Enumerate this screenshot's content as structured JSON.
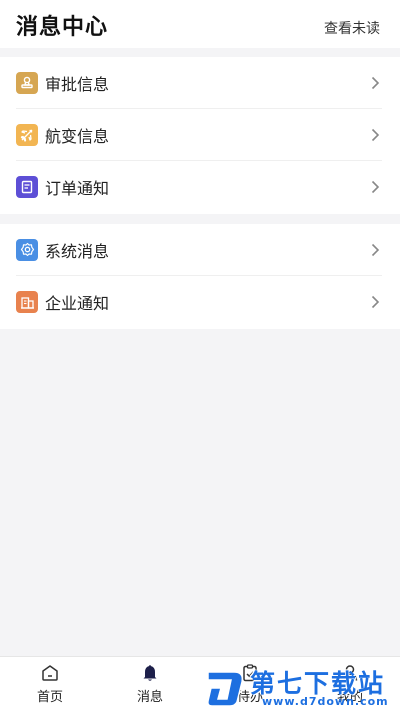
{
  "header": {
    "title": "消息中心",
    "view_unread": "查看未读"
  },
  "groups": [
    {
      "items": [
        {
          "label": "审批信息",
          "icon": "stamp-icon",
          "color": "#d6a652"
        },
        {
          "label": "航变信息",
          "icon": "airplane-icon",
          "color": "#f2b552"
        },
        {
          "label": "订单通知",
          "icon": "document-icon",
          "color": "#5d4fd6"
        }
      ]
    },
    {
      "items": [
        {
          "label": "系统消息",
          "icon": "gear-icon",
          "color": "#4a8fe4"
        },
        {
          "label": "企业通知",
          "icon": "building-icon",
          "color": "#e8824e"
        }
      ]
    }
  ],
  "tabbar": {
    "tabs": [
      {
        "label": "首页",
        "icon": "home-icon"
      },
      {
        "label": "消息",
        "icon": "bell-icon",
        "active": true
      },
      {
        "label": "待办",
        "icon": "clipboard-check-icon"
      },
      {
        "label": "我的",
        "icon": "user-icon"
      }
    ]
  },
  "watermark": {
    "title": "第七下载站",
    "url": "www.d7down.com",
    "color": "#1d6fe0"
  }
}
